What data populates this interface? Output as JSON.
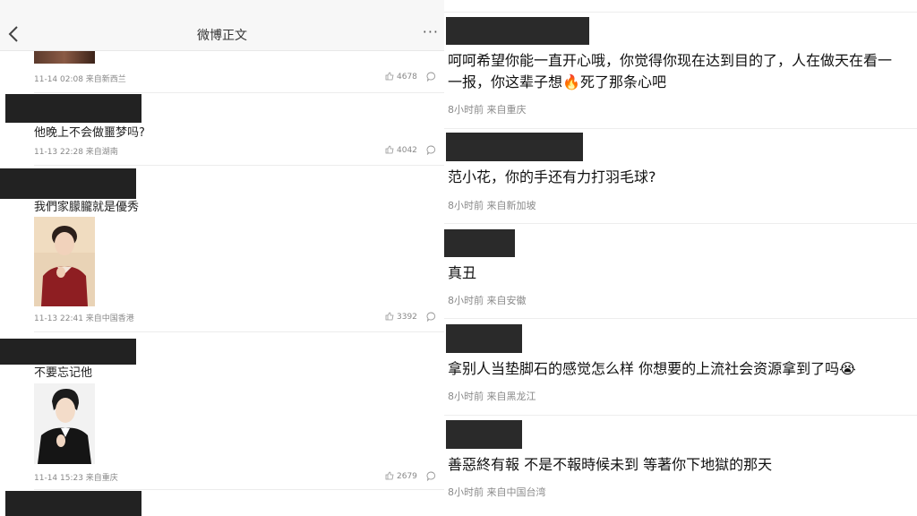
{
  "header": {
    "title": "微博正文",
    "more": "···"
  },
  "left_comments": [
    {
      "meta": "11-14 02:08 来自新西兰",
      "likes": "4678"
    },
    {
      "text": "他晚上不会做噩梦吗?",
      "meta": "11-13 22:28 来自湖南",
      "likes": "4042"
    },
    {
      "text": "我們家朦朧就是優秀",
      "meta": "11-13 22:41 来自中国香港",
      "likes": "3392"
    },
    {
      "text": "不要忘记他",
      "meta": "11-14 15:23 来自重庆",
      "likes": "2679"
    }
  ],
  "right_comments": [
    {
      "line1": "呵呵希望你能一直开心哦，你觉得你现在达到目的了，人在做天在看一",
      "line2_a": "一报，你这辈子想",
      "line2_emoji": "🔥",
      "line2_b": "死了那条心吧",
      "meta": "8小时前 来自重庆"
    },
    {
      "text": "范小花，你的手还有力打羽毛球?",
      "meta": "8小时前 来自新加坡"
    },
    {
      "text": "真丑",
      "meta": "8小时前 来自安徽"
    },
    {
      "text": "拿别人当垫脚石的感觉怎么样 你想要的上流社会资源拿到了吗",
      "emoji": "😭",
      "meta": "8小时前 来自黑龙江"
    },
    {
      "text": "善惡終有報 不是不報時候未到 等著你下地獄的那天",
      "meta": "8小时前 来自中国台湾"
    }
  ],
  "colors": {
    "mask": "#222222",
    "meta_text": "#888888",
    "separator": "#ececec",
    "header_bg": "#f7f7f7"
  },
  "icons": [
    "back-chevron-icon",
    "more-dots-icon",
    "like-thumb-icon",
    "reply-bubble-icon"
  ]
}
